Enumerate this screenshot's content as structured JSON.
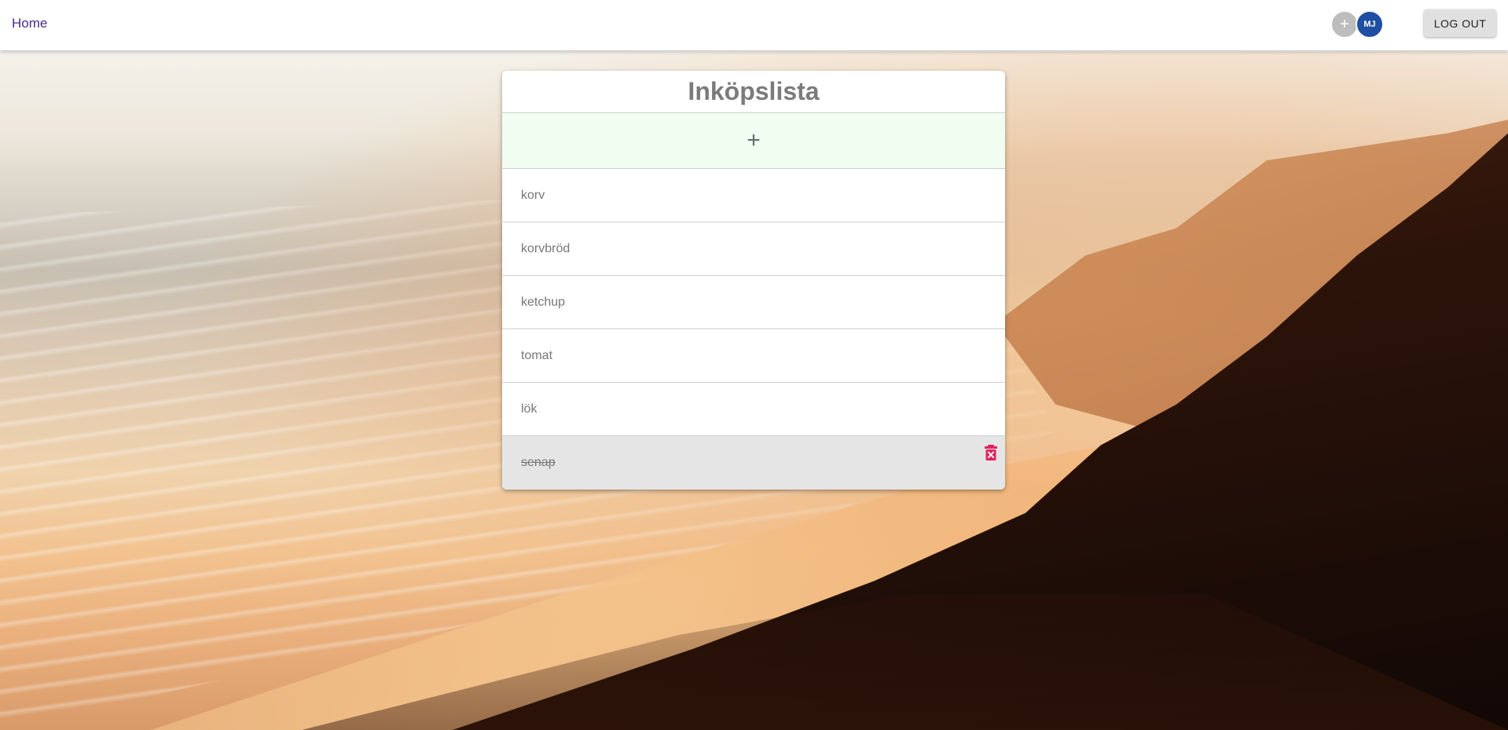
{
  "nav": {
    "home_label": "Home"
  },
  "header": {
    "share_icon_glyph": "+",
    "avatar_initials": "MJ",
    "logout_label": "LOG OUT"
  },
  "list": {
    "title": "Inköpslista",
    "add_icon_glyph": "+",
    "items": [
      {
        "label": "korv",
        "checked": false
      },
      {
        "label": "korvbröd",
        "checked": false
      },
      {
        "label": "ketchup",
        "checked": false
      },
      {
        "label": "tomat",
        "checked": false
      },
      {
        "label": "lök",
        "checked": false
      },
      {
        "label": "senap",
        "checked": true
      }
    ]
  },
  "colors": {
    "link": "#4a2a8a",
    "avatar_bg": "#1f4ea3",
    "add_row_bg": "#f1fdf0",
    "checked_row_bg": "#e5e5e5",
    "delete_icon": "#e0245e"
  },
  "icons": {
    "share": "plus-icon",
    "delete": "trash-icon"
  }
}
